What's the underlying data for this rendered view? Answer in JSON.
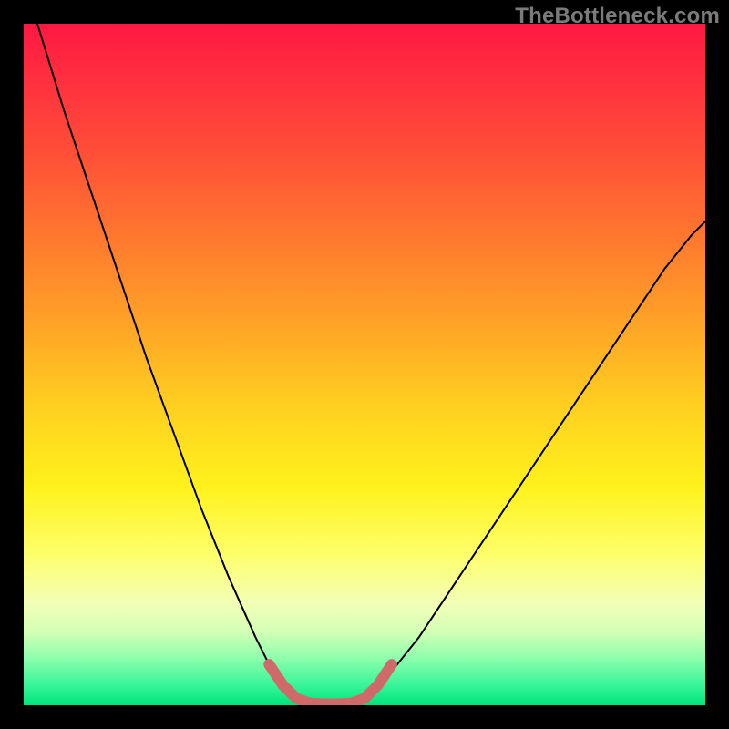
{
  "watermark": "TheBottleneck.com",
  "chart_data": {
    "type": "line",
    "title": "",
    "xlabel": "",
    "ylabel": "",
    "xlim": [
      0,
      100
    ],
    "ylim": [
      0,
      100
    ],
    "grid": false,
    "legend": false,
    "series": [
      {
        "name": "left-curve",
        "x": [
          2,
          6,
          10,
          14,
          18,
          22,
          26,
          30,
          34,
          36,
          38,
          40
        ],
        "y": [
          100,
          87,
          75,
          63,
          51,
          40,
          29,
          19,
          10,
          6,
          3,
          1
        ],
        "stroke": "#000000",
        "width": 2
      },
      {
        "name": "right-curve",
        "x": [
          50,
          54,
          58,
          62,
          66,
          70,
          74,
          78,
          82,
          86,
          90,
          94,
          98,
          100
        ],
        "y": [
          1,
          5,
          10,
          16,
          22,
          28,
          34,
          40,
          46,
          52,
          58,
          64,
          69,
          71
        ],
        "stroke": "#000000",
        "width": 2
      },
      {
        "name": "valley-highlight",
        "x": [
          36,
          38,
          40,
          42,
          44,
          46,
          48,
          50,
          52,
          54
        ],
        "y": [
          6,
          3,
          1,
          0.3,
          0.2,
          0.2,
          0.3,
          1,
          3,
          6
        ],
        "stroke": "#d06a6a",
        "width": 12,
        "linecap": "round"
      }
    ]
  }
}
